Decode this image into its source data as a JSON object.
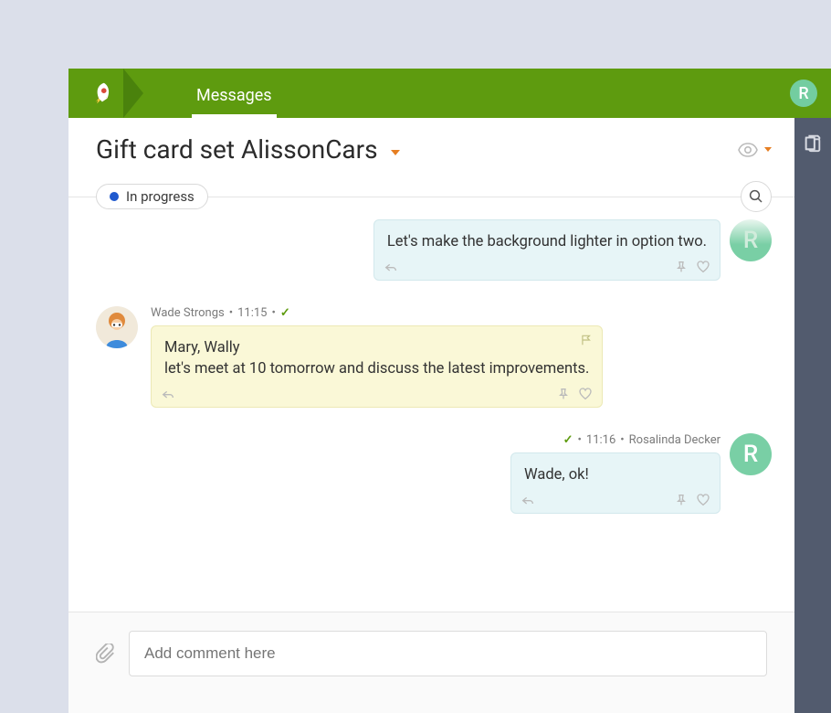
{
  "header": {
    "tabs": [
      {
        "label": "Messages",
        "active": true
      }
    ],
    "avatar_initial": "R"
  },
  "page": {
    "title": "Gift card set AlissonCars",
    "status": "In progress"
  },
  "thread": {
    "m1": {
      "text": "Let's make the background lighter in option two.",
      "avatar_initial": "R"
    },
    "m2": {
      "author": "Wade Strongs",
      "time": "11:15",
      "line1": "Mary, Wally",
      "line2": "let's meet at 10 tomorrow and discuss the latest improvements."
    },
    "m3": {
      "author": "Rosalinda Decker",
      "time": "11:16",
      "text": "Wade, ok!",
      "avatar_initial": "R"
    }
  },
  "composer": {
    "placeholder": "Add comment here"
  }
}
